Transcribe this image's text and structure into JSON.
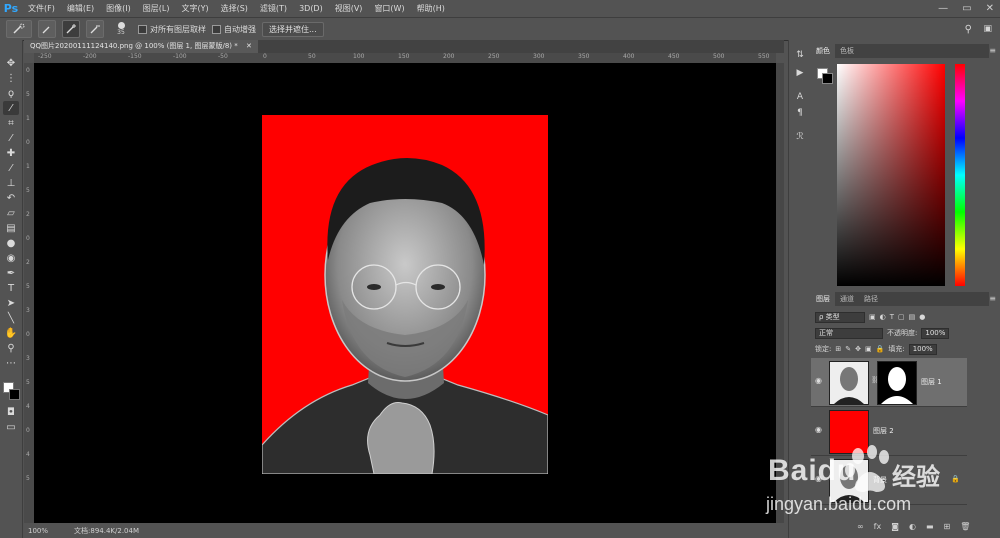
{
  "app": {
    "logo": "Ps"
  },
  "menu": [
    "文件(F)",
    "编辑(E)",
    "图像(I)",
    "图层(L)",
    "文字(Y)",
    "选择(S)",
    "滤镜(T)",
    "3D(D)",
    "视图(V)",
    "窗口(W)",
    "帮助(H)"
  ],
  "window_controls": {
    "minimize": "—",
    "restore": "▭",
    "close": "✕"
  },
  "options": {
    "brush_size": "35",
    "sample_all_layers": "对所有图层取样",
    "auto_enhance": "自动增强",
    "select_and_mask": "选择并遮住..."
  },
  "document": {
    "tab_title": "QQ图片20200111124140.png @ 100% (图层 1, 图层蒙版/8) *",
    "tab_close": "✕"
  },
  "ruler": {
    "top_ticks": [
      "-250",
      "-200",
      "-150",
      "-100",
      "-50",
      "0",
      "50",
      "100",
      "150",
      "200",
      "250",
      "300",
      "350",
      "400",
      "450",
      "500",
      "550"
    ],
    "left_ticks": [
      "0",
      "5",
      "1",
      "0",
      "1",
      "5",
      "2",
      "0",
      "2",
      "5",
      "3",
      "0",
      "3",
      "5",
      "4",
      "0",
      "4",
      "5"
    ]
  },
  "status": {
    "zoom": "100%",
    "doc_info": "文档:894.4K/2.04M"
  },
  "color_panel": {
    "tabs": [
      "颜色",
      "色板"
    ],
    "menu_icon": "≡"
  },
  "layers_panel": {
    "tabs": [
      "图层",
      "通道",
      "路径"
    ],
    "filter_label": "ρ 类型",
    "blend_mode": "正常",
    "opacity_label": "不透明度:",
    "opacity_value": "100%",
    "lock_label": "锁定:",
    "fill_label": "填充:",
    "fill_value": "100%",
    "layers": [
      {
        "name": "图层 1",
        "selected": true,
        "has_mask": true
      },
      {
        "name": "图层 2",
        "selected": false,
        "has_mask": false
      },
      {
        "name": "背景",
        "selected": false,
        "has_mask": false,
        "locked": true
      }
    ],
    "footer_icons": [
      "link-icon",
      "fx-icon",
      "mask-icon",
      "adjustment-icon",
      "folder-icon",
      "new-layer-icon",
      "trash-icon"
    ],
    "footer_fx": "fx"
  },
  "watermark": {
    "brand": "Baidu",
    "suffix": "经验",
    "url": "jingyan.baidu.com"
  }
}
